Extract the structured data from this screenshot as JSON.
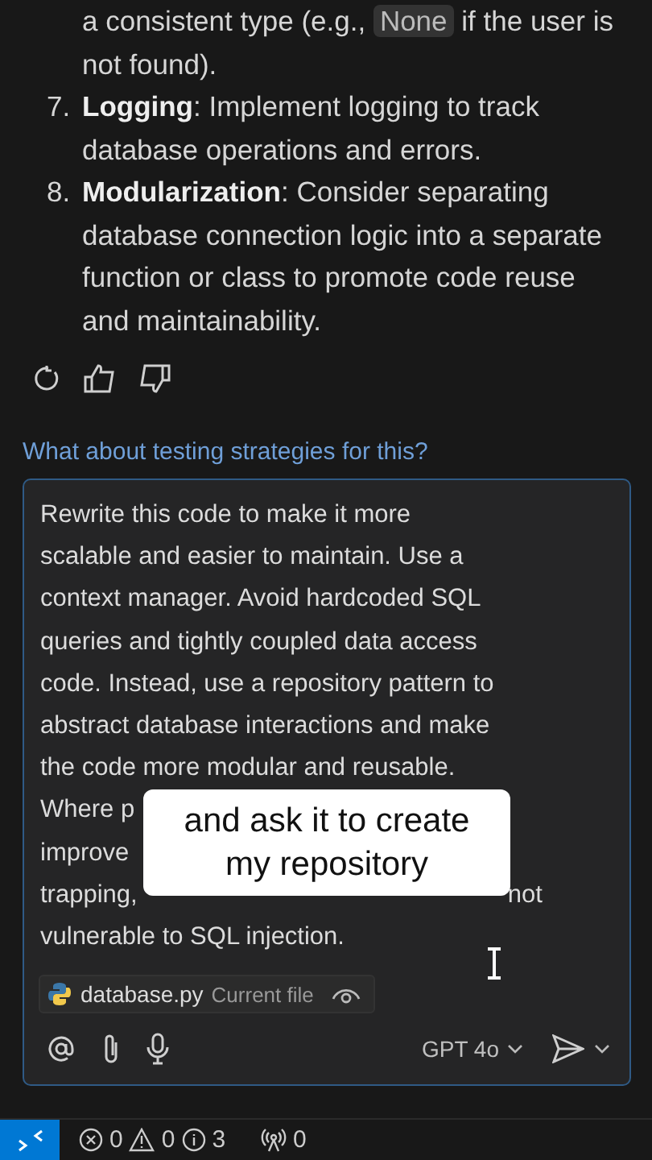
{
  "response": {
    "continuation": {
      "before": "a consistent type (e.g., ",
      "code": "None",
      "after": " if the user is not found)."
    },
    "items": [
      {
        "number": "7.",
        "text": "**Logging**: Implement logging to track database operations and errors."
      },
      {
        "number": "8.",
        "text": "**Modularization**: Consider separating database connection logic into a separate function or class to promote code reuse and maintainability."
      }
    ]
  },
  "actions": [
    {
      "kind": "retry"
    },
    {
      "kind": "thumbs-up"
    },
    {
      "kind": "thumbs-down"
    }
  ],
  "suggestion": "What about testing strategies for this?",
  "prompt": {
    "lines": [
      {
        "left": "Rewrite this code to make it more"
      },
      {
        "left": "scalable and easier to maintain. Use a"
      },
      {
        "left": "context manager. Avoid hardcoded SQL"
      },
      {
        "left": "queries and tightly coupled data access"
      },
      {
        "left": "code. Instead, use a repository pattern to"
      },
      {
        "left": "abstract database interactions and make"
      },
      {
        "left": "the code more modular and reusable."
      },
      {
        "left": "Where p"
      },
      {
        "left": "improve"
      },
      {
        "left": "trapping,",
        "right": "not"
      },
      {
        "left": "vulnerable to SQL injection."
      }
    ],
    "file": {
      "name": "database.py",
      "label": "Current file"
    },
    "model": "GPT 4o"
  },
  "caption": [
    "and ask it to create",
    "my repository"
  ],
  "status_bar": {
    "errors": "0",
    "warnings": "0",
    "infos": "3",
    "ports": "0"
  }
}
